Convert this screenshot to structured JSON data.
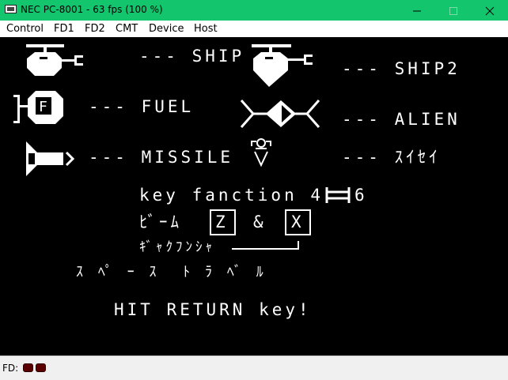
{
  "window": {
    "title": "NEC PC-8001 - 63 fps (100 %)"
  },
  "menu": {
    "items": [
      "Control",
      "FD1",
      "FD2",
      "CMT",
      "Device",
      "Host"
    ]
  },
  "screen": {
    "ship_label": "--- SHIP",
    "fuel_label": "--- FUEL",
    "missile_label": "--- MISSILE",
    "ship2_label": "--- SHIP2",
    "alien_label": "--- ALIEN",
    "suisei_label": "--- ｽｲｾｲ",
    "fuel_letter": "F",
    "key_function": "key fanction 4",
    "key_function_end": "6",
    "beam_label": "ﾋﾞｰﾑ",
    "key_z": "Z",
    "ampersand": "&",
    "key_x": "X",
    "gyakufunsha": "ｷﾞｬｸﾌﾝｼｬ",
    "game_title": "ｽ ﾍﾟ ｰ ｽ  ﾄ ﾗ ﾍﾞ ﾙ",
    "hit_return": "HIT RETURN key!"
  },
  "status": {
    "label": "FD:",
    "drives": [
      "fd1-led",
      "fd2-led"
    ]
  },
  "colors": {
    "titlebar": "#13c66e",
    "screen_bg": "#000000",
    "screen_fg": "#ffffff",
    "led": "#5a0000"
  }
}
